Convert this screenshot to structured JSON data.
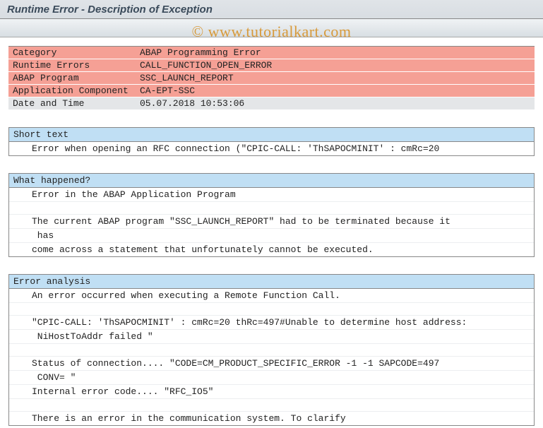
{
  "header": {
    "title": "Runtime Error - Description of Exception"
  },
  "watermark": "© www.tutorialkart.com",
  "info": {
    "rows": [
      {
        "label": "Category",
        "value": "ABAP Programming Error",
        "style": "red"
      },
      {
        "label": "Runtime Errors",
        "value": "CALL_FUNCTION_OPEN_ERROR",
        "style": "red"
      },
      {
        "label": "ABAP Program",
        "value": "SSC_LAUNCH_REPORT",
        "style": "red"
      },
      {
        "label": "Application Component",
        "value": "CA-EPT-SSC",
        "style": "red"
      },
      {
        "label": "Date and Time",
        "value": "05.07.2018 10:53:06",
        "style": "grey"
      }
    ]
  },
  "sections": [
    {
      "title": "Short text",
      "lines": [
        "Error when opening an RFC connection (\"CPIC-CALL: 'ThSAPOCMINIT' : cmRc=20"
      ]
    },
    {
      "title": "What happened?",
      "lines": [
        "Error in the ABAP Application Program",
        "",
        "The current ABAP program \"SSC_LAUNCH_REPORT\" had to be terminated because it",
        " has",
        "come across a statement that unfortunately cannot be executed."
      ]
    },
    {
      "title": "Error analysis",
      "lines": [
        "An error occurred when executing a Remote Function Call.",
        "",
        "\"CPIC-CALL: 'ThSAPOCMINIT' : cmRc=20 thRc=497#Unable to determine host address:",
        " NiHostToAddr failed \"",
        "",
        "Status of connection.... \"CODE=CM_PRODUCT_SPECIFIC_ERROR -1 -1 SAPCODE=497",
        " CONV= \"",
        "Internal error code.... \"RFC_IO5\"",
        "",
        "There is an error in the communication system. To clarify"
      ]
    }
  ]
}
